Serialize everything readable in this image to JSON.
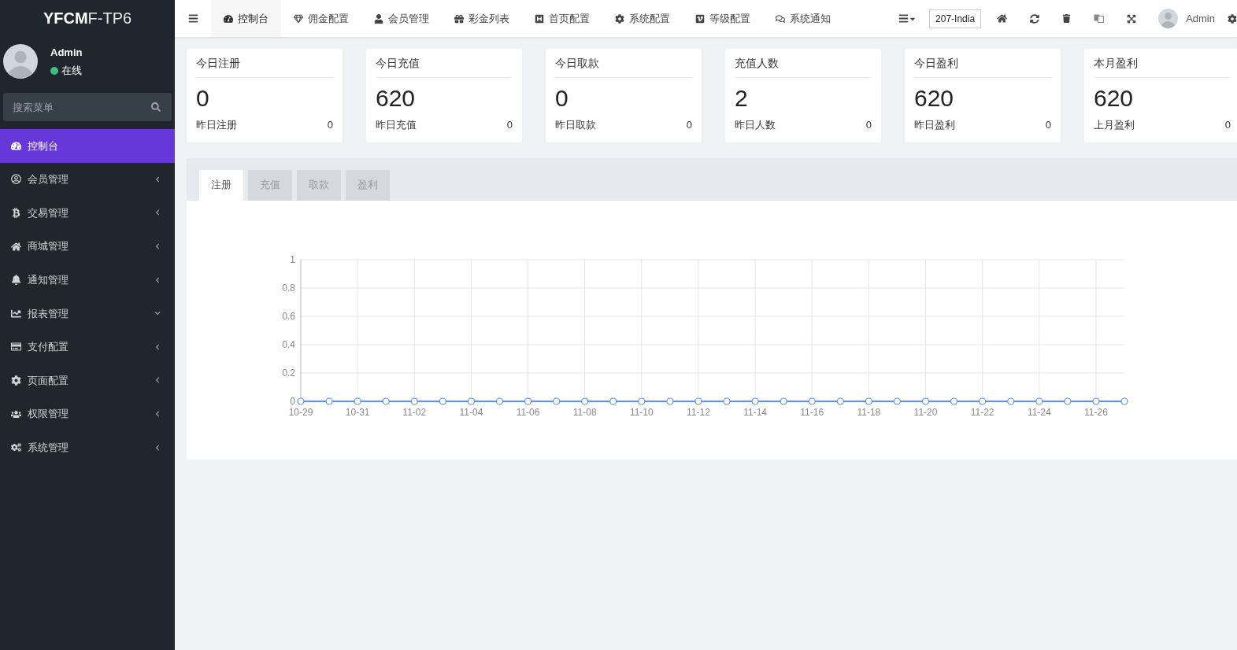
{
  "brand": {
    "bold": "YFCM",
    "light": "F-TP6"
  },
  "user": {
    "name": "Admin",
    "status": "在线",
    "online": true
  },
  "sidebar": {
    "search_placeholder": "搜索菜单",
    "items": [
      {
        "label": "控制台",
        "selected": true,
        "kind": "plain"
      },
      {
        "label": "会员管理",
        "selected": false,
        "kind": "group",
        "expanded": false
      },
      {
        "label": "交易管理",
        "selected": false,
        "kind": "group",
        "expanded": false
      },
      {
        "label": "商城管理",
        "selected": false,
        "kind": "group",
        "expanded": false
      },
      {
        "label": "通知管理",
        "selected": false,
        "kind": "group",
        "expanded": false
      },
      {
        "label": "报表管理",
        "selected": false,
        "kind": "group",
        "expanded": true
      },
      {
        "label": "支付配置",
        "selected": false,
        "kind": "group",
        "expanded": false
      },
      {
        "label": "页面配置",
        "selected": false,
        "kind": "group",
        "expanded": false
      },
      {
        "label": "权限管理",
        "selected": false,
        "kind": "group",
        "expanded": false
      },
      {
        "label": "系统管理",
        "selected": false,
        "kind": "group",
        "expanded": false
      }
    ]
  },
  "top_nav": {
    "tabs": [
      {
        "label": "控制台",
        "selected": true
      },
      {
        "label": "佣金配置",
        "selected": false
      },
      {
        "label": "会员管理",
        "selected": false
      },
      {
        "label": "彩金列表",
        "selected": false
      },
      {
        "label": "首页配置",
        "selected": false
      },
      {
        "label": "系统配置",
        "selected": false
      },
      {
        "label": "等级配置",
        "selected": false
      },
      {
        "label": "系统通知",
        "selected": false
      }
    ],
    "site": "207-India",
    "user": "Admin"
  },
  "stats": [
    {
      "title": "今日注册",
      "value": "0",
      "sub_label": "昨日注册",
      "sub_value": "0"
    },
    {
      "title": "今日充值",
      "value": "620",
      "sub_label": "昨日充值",
      "sub_value": "0"
    },
    {
      "title": "今日取款",
      "value": "0",
      "sub_label": "昨日取款",
      "sub_value": "0"
    },
    {
      "title": "充值人数",
      "value": "2",
      "sub_label": "昨日人数",
      "sub_value": "0"
    },
    {
      "title": "今日盈利",
      "value": "620",
      "sub_label": "昨日盈利",
      "sub_value": "0"
    },
    {
      "title": "本月盈利",
      "value": "620",
      "sub_label": "上月盈利",
      "sub_value": "0"
    }
  ],
  "chart_panel": {
    "tabs": [
      {
        "label": "注册",
        "selected": true
      },
      {
        "label": "充值",
        "selected": false
      },
      {
        "label": "取款",
        "selected": false
      },
      {
        "label": "盈利",
        "selected": false
      }
    ],
    "chart_data": {
      "type": "line",
      "grid": true,
      "categories": [
        "10-29",
        null,
        "10-31",
        null,
        "11-02",
        null,
        "11-04",
        null,
        "11-06",
        null,
        "11-08",
        null,
        "11-10",
        null,
        "11-12",
        null,
        "11-14",
        null,
        "11-16",
        null,
        "11-18",
        null,
        "11-20",
        null,
        "11-22",
        null,
        "11-24",
        null,
        "11-26",
        null
      ],
      "series": [
        {
          "color": "#5b8ff9",
          "marker": "circle",
          "values": [
            0,
            0,
            0,
            0,
            0,
            0,
            0,
            0,
            0,
            0,
            0,
            0,
            0,
            0,
            0,
            0,
            0,
            0,
            0,
            0,
            0,
            0,
            0,
            0,
            0,
            0,
            0,
            0,
            0,
            0
          ]
        }
      ],
      "ylim": [
        0,
        1
      ],
      "yticks": [
        0,
        0.2,
        0.4,
        0.6,
        0.8,
        1
      ]
    }
  }
}
